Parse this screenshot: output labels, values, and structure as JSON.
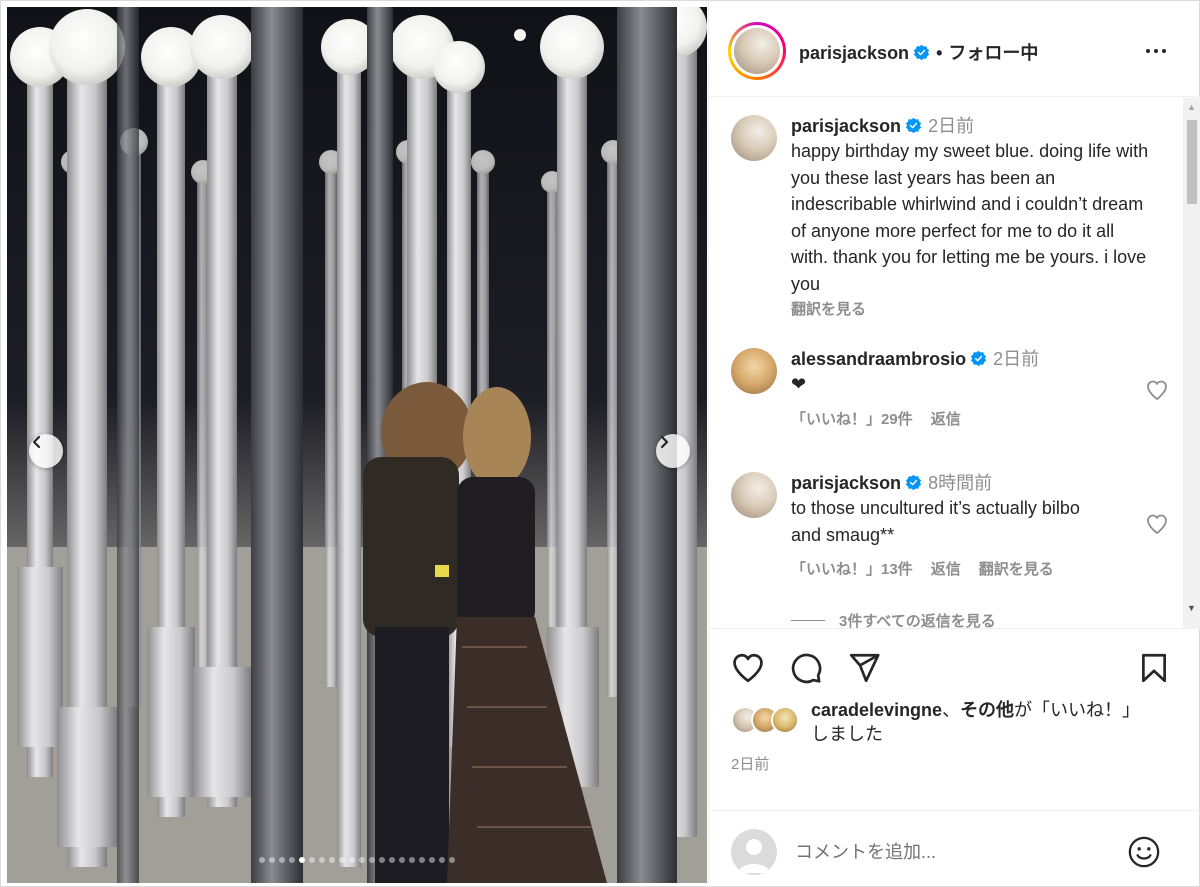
{
  "post": {
    "author": "parisjackson",
    "follow_label": "フォロー中",
    "separator": "•",
    "carousel": {
      "total_slides": 20,
      "active_slide": 5
    }
  },
  "caption": {
    "username": "parisjackson",
    "time": "2日前",
    "text": "happy birthday my sweet blue. doing life with you these last years has been an indescribable whirlwind and i couldn’t dream of anyone more perfect for me to do it all with. thank you for letting me be yours. i love you",
    "translate": "翻訳を見る"
  },
  "comments": [
    {
      "username": "alessandraambrosio",
      "time": "2日前",
      "text": "❤",
      "likes": "「いいね！」29件",
      "reply": "返信"
    },
    {
      "username": "parisjackson",
      "time": "8時間前",
      "text": "to those uncultured it’s actually bilbo and smaug**",
      "likes": "「いいね！」13件",
      "reply": "返信",
      "translate": "翻訳を見る"
    }
  ],
  "view_replies": "3件すべての返信を見る",
  "likes_summary": {
    "user": "caradelevingne",
    "sep": "、",
    "others": "その他",
    "suffix": "が「いいね！」しました"
  },
  "post_date": "2日前",
  "comment_box": {
    "placeholder": "コメントを追加..."
  },
  "icons": {
    "heart": "heart-icon",
    "comment": "comment-icon",
    "share": "paper-plane-icon",
    "save": "bookmark-icon",
    "more": "more-icon",
    "emoji": "emoji-icon",
    "verified": "verified-badge-icon"
  },
  "colors": {
    "verified": "#0095f6",
    "text": "#262626",
    "muted": "#8e8e8e"
  }
}
